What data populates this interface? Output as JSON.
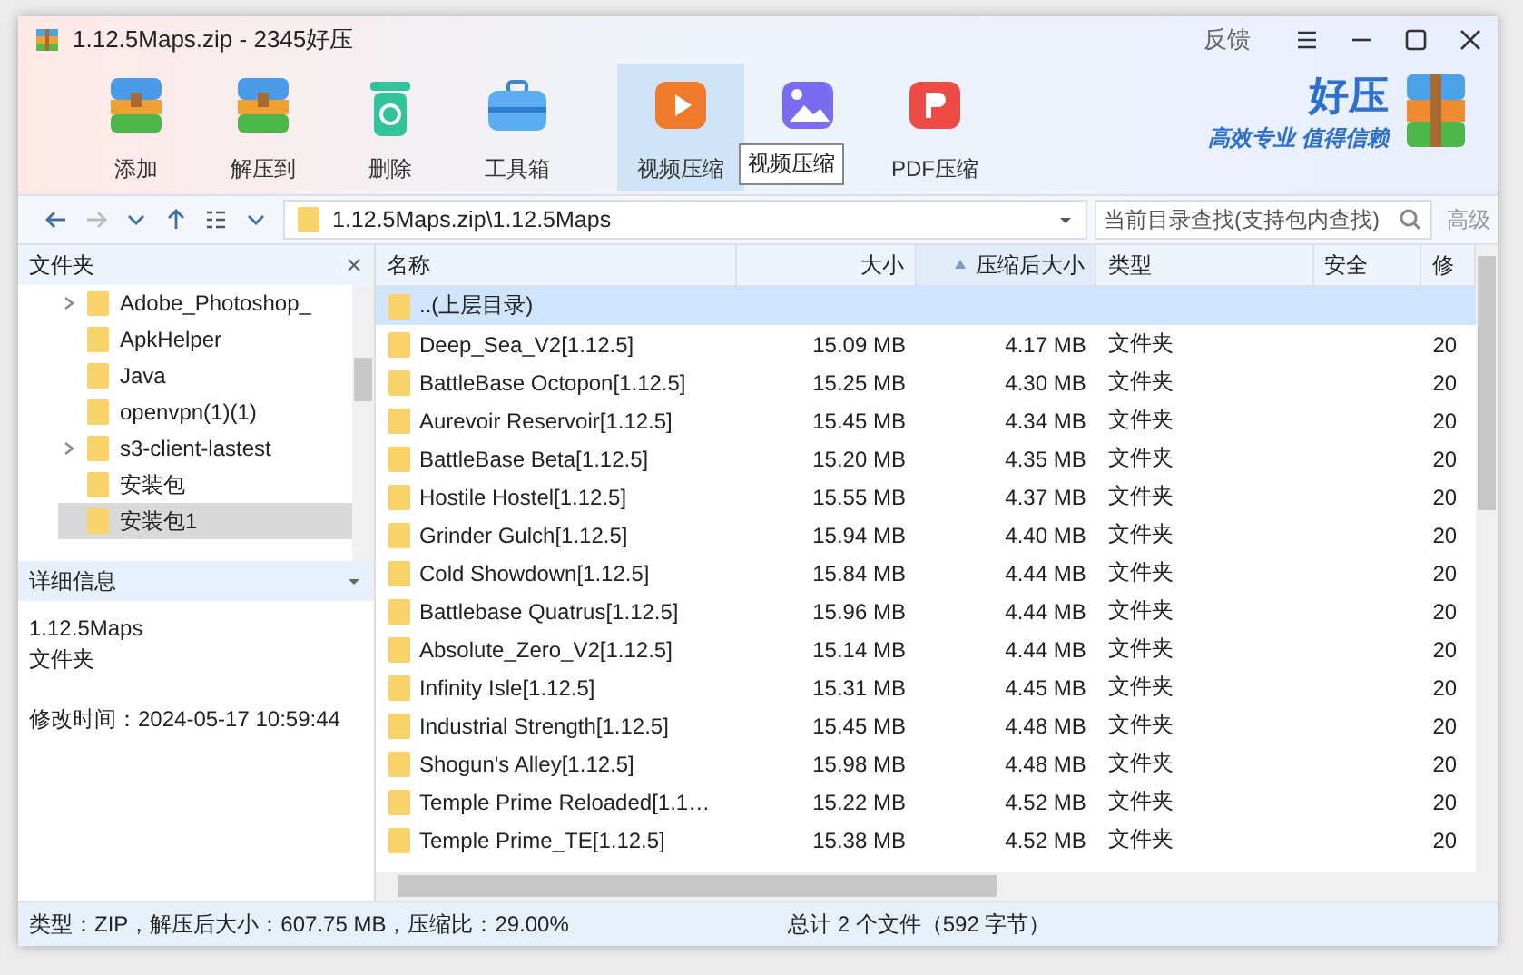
{
  "window": {
    "title": "1.12.5Maps.zip - 2345好压",
    "feedback": "反馈"
  },
  "toolbar": [
    {
      "label": "添加",
      "kind": "add",
      "hovered": false
    },
    {
      "label": "解压到",
      "kind": "extract",
      "hovered": false
    },
    {
      "label": "删除",
      "kind": "delete",
      "hovered": false
    },
    {
      "label": "工具箱",
      "kind": "toolbox",
      "hovered": false
    },
    {
      "label": "视频压缩",
      "kind": "video",
      "hovered": true
    },
    {
      "kind": "image",
      "hovered": false
    },
    {
      "label": "PDF压缩",
      "kind": "pdf",
      "hovered": false
    }
  ],
  "tooltip": "视频压缩",
  "logo": {
    "name": "好压",
    "slogan": "高效专业 值得信赖"
  },
  "nav": {
    "path": "1.12.5Maps.zip\\1.12.5Maps",
    "search_placeholder": "当前目录查找(支持包内查找)",
    "advanced": "高级"
  },
  "folders": {
    "title": "文件夹",
    "items": [
      {
        "label": "Adobe_Photoshop_",
        "expandable": true,
        "selected": false
      },
      {
        "label": "ApkHelper",
        "expandable": false,
        "selected": false
      },
      {
        "label": "Java",
        "expandable": false,
        "selected": false
      },
      {
        "label": "openvpn(1)(1)",
        "expandable": false,
        "selected": false
      },
      {
        "label": "s3-client-lastest",
        "expandable": true,
        "selected": false
      },
      {
        "label": "安装包",
        "expandable": false,
        "selected": false
      },
      {
        "label": "安装包1",
        "expandable": false,
        "selected": true
      }
    ]
  },
  "details": {
    "title": "详细信息",
    "name": "1.12.5Maps",
    "type": "文件夹",
    "modified": "修改时间：2024-05-17 10:59:44"
  },
  "table": {
    "columns": [
      {
        "label": "名称",
        "sorted": false
      },
      {
        "label": "大小",
        "sorted": false
      },
      {
        "label": "压缩后大小",
        "sorted": true
      },
      {
        "label": "类型",
        "sorted": false
      },
      {
        "label": "安全",
        "sorted": false
      },
      {
        "label": "修",
        "sorted": false
      }
    ],
    "rows": [
      {
        "name": "..(上层目录)",
        "selected": true
      },
      {
        "name": "Deep_Sea_V2[1.12.5]",
        "size": "15.09 MB",
        "packed": "4.17 MB",
        "type": "文件夹",
        "modified": "20",
        "selected": false
      },
      {
        "name": "BattleBase Octopon[1.12.5]",
        "size": "15.25 MB",
        "packed": "4.30 MB",
        "type": "文件夹",
        "modified": "20",
        "selected": false
      },
      {
        "name": "Aurevoir Reservoir[1.12.5]",
        "size": "15.45 MB",
        "packed": "4.34 MB",
        "type": "文件夹",
        "modified": "20",
        "selected": false
      },
      {
        "name": "BattleBase Beta[1.12.5]",
        "size": "15.20 MB",
        "packed": "4.35 MB",
        "type": "文件夹",
        "modified": "20",
        "selected": false
      },
      {
        "name": "Hostile Hostel[1.12.5]",
        "size": "15.55 MB",
        "packed": "4.37 MB",
        "type": "文件夹",
        "modified": "20",
        "selected": false
      },
      {
        "name": "Grinder Gulch[1.12.5]",
        "size": "15.94 MB",
        "packed": "4.40 MB",
        "type": "文件夹",
        "modified": "20",
        "selected": false
      },
      {
        "name": "Cold Showdown[1.12.5]",
        "size": "15.84 MB",
        "packed": "4.44 MB",
        "type": "文件夹",
        "modified": "20",
        "selected": false
      },
      {
        "name": "Battlebase Quatrus[1.12.5]",
        "size": "15.96 MB",
        "packed": "4.44 MB",
        "type": "文件夹",
        "modified": "20",
        "selected": false
      },
      {
        "name": "Absolute_Zero_V2[1.12.5]",
        "size": "15.14 MB",
        "packed": "4.44 MB",
        "type": "文件夹",
        "modified": "20",
        "selected": false
      },
      {
        "name": "Infinity Isle[1.12.5]",
        "size": "15.31 MB",
        "packed": "4.45 MB",
        "type": "文件夹",
        "modified": "20",
        "selected": false
      },
      {
        "name": "Industrial Strength[1.12.5]",
        "size": "15.45 MB",
        "packed": "4.48 MB",
        "type": "文件夹",
        "modified": "20",
        "selected": false
      },
      {
        "name": "Shogun's Alley[1.12.5]",
        "size": "15.98 MB",
        "packed": "4.48 MB",
        "type": "文件夹",
        "modified": "20",
        "selected": false
      },
      {
        "name": "Temple Prime Reloaded[1.1…",
        "size": "15.22 MB",
        "packed": "4.52 MB",
        "type": "文件夹",
        "modified": "20",
        "selected": false
      },
      {
        "name": "Temple Prime_TE[1.12.5]",
        "size": "15.38 MB",
        "packed": "4.52 MB",
        "type": "文件夹",
        "modified": "20",
        "selected": false
      }
    ]
  },
  "status_bar": {
    "left": "类型：ZIP，解压后大小：607.75 MB，压缩比：29.00%",
    "right": "总计 2 个文件（592 字节）"
  }
}
